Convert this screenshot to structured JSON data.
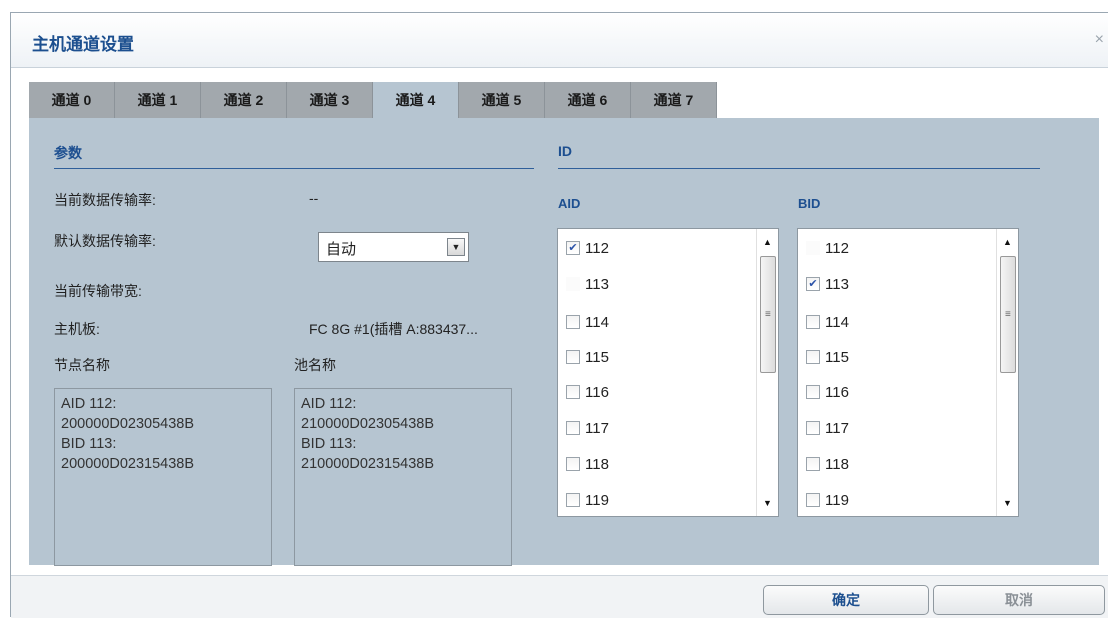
{
  "dialog": {
    "title": "主机通道设置",
    "close_icon": "×"
  },
  "tabs": [
    "通道 0",
    "通道 1",
    "通道 2",
    "通道 3",
    "通道 4",
    "通道 5",
    "通道 6",
    "通道 7"
  ],
  "active_tab": "通道 4",
  "params": {
    "section_title": "参数",
    "current_rate_label": "当前数据传输率:",
    "current_rate_value": "--",
    "default_rate_label": "默认数据传输率:",
    "default_rate_value": "自动",
    "bandwidth_label": "当前传输带宽:",
    "board_label": "主机板:",
    "board_value": "FC 8G #1(插槽 A:883437...",
    "node_name_label": "节点名称",
    "pool_name_label": "池名称",
    "node_names": [
      "AID 112:",
      "200000D02305438B",
      "BID 113:",
      "200000D02315438B"
    ],
    "pool_names": [
      "AID 112:",
      "210000D02305438B",
      "BID 113:",
      "210000D02315438B"
    ]
  },
  "id_section": {
    "title": "ID",
    "aid_label": "AID",
    "bid_label": "BID",
    "aid_items": [
      {
        "label": "112",
        "checked": true
      },
      {
        "label": "113",
        "checked": false
      },
      {
        "label": "114",
        "checked": false
      },
      {
        "label": "115",
        "checked": false
      },
      {
        "label": "116",
        "checked": false
      },
      {
        "label": "117",
        "checked": false
      },
      {
        "label": "118",
        "checked": false
      },
      {
        "label": "119",
        "checked": false
      }
    ],
    "bid_items": [
      {
        "label": "112",
        "checked": false
      },
      {
        "label": "113",
        "checked": true
      },
      {
        "label": "114",
        "checked": false
      },
      {
        "label": "115",
        "checked": false
      },
      {
        "label": "116",
        "checked": false
      },
      {
        "label": "117",
        "checked": false
      },
      {
        "label": "118",
        "checked": false
      },
      {
        "label": "119",
        "checked": false
      }
    ]
  },
  "footer": {
    "ok_label": "确定",
    "cancel_label": "取消"
  }
}
